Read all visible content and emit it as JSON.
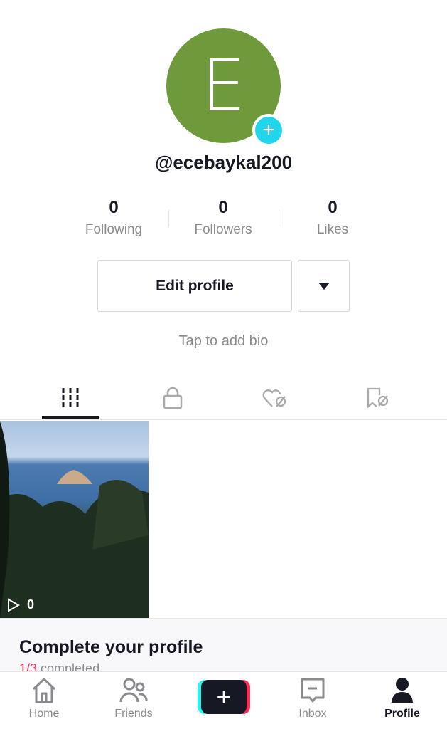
{
  "profile": {
    "initial": "E",
    "username": "@ecebaykal200",
    "avatar_color": "#6f9a3c"
  },
  "stats": [
    {
      "value": "0",
      "label": "Following"
    },
    {
      "value": "0",
      "label": "Followers"
    },
    {
      "value": "0",
      "label": "Likes"
    }
  ],
  "actions": {
    "edit_profile": "Edit profile"
  },
  "bio_placeholder": "Tap to add bio",
  "tabs": [
    {
      "icon": "grid-icon",
      "active": true
    },
    {
      "icon": "lock-icon"
    },
    {
      "icon": "heart-hidden-icon"
    },
    {
      "icon": "bookmark-hidden-icon"
    }
  ],
  "videos": [
    {
      "views": "0"
    }
  ],
  "complete_card": {
    "title": "Complete your profile",
    "progress": "1/3",
    "progress_text": " completed",
    "accent": "#fe2c55"
  },
  "nav": [
    {
      "label": "Home"
    },
    {
      "label": "Friends"
    },
    {
      "label": "Inbox"
    },
    {
      "label": "Profile",
      "active": true
    }
  ]
}
